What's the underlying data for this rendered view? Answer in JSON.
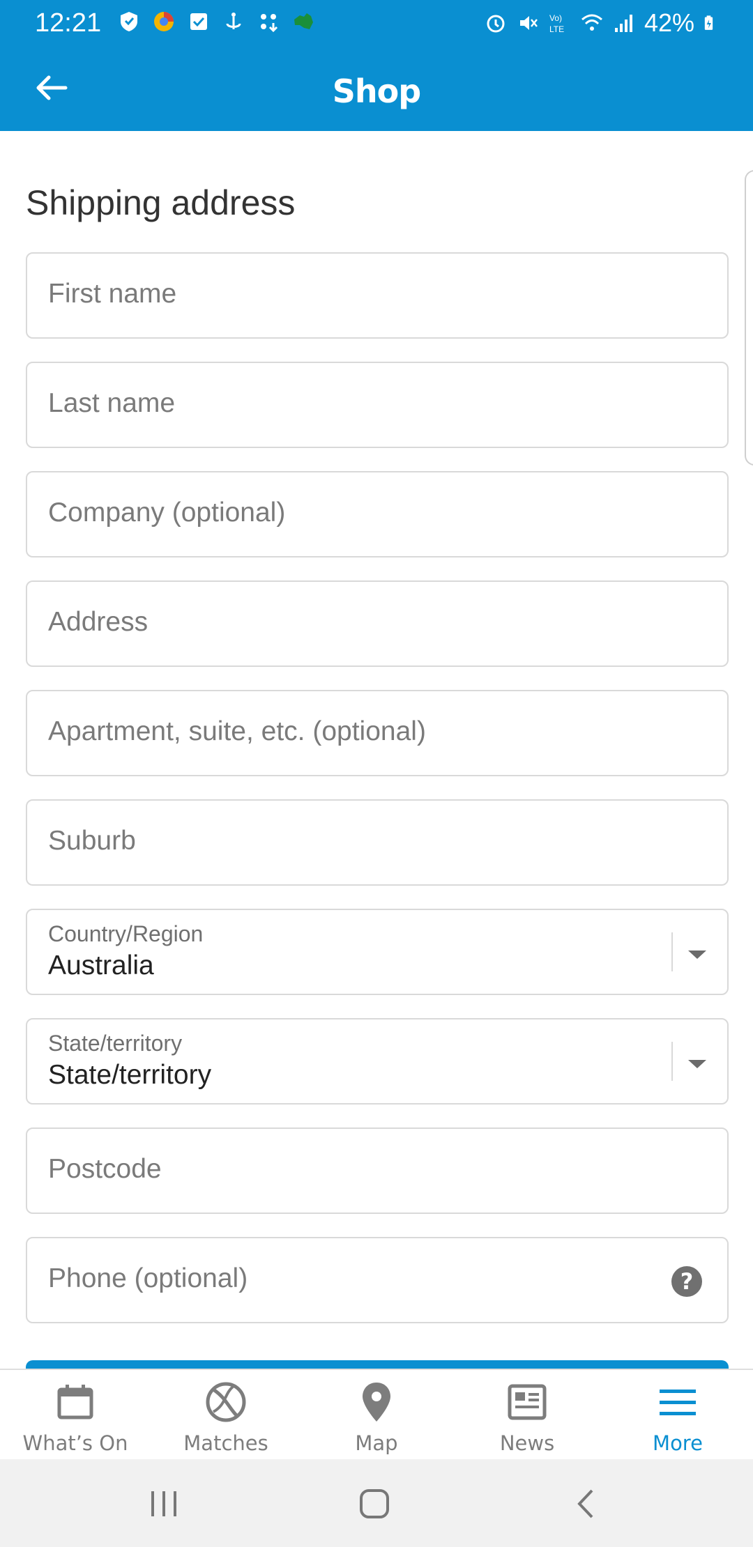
{
  "status_bar": {
    "time": "12:21",
    "battery": "42%",
    "left_icons": [
      "shield-icon",
      "browser-icon",
      "checkbox-app-icon",
      "anchor-icon",
      "apps-download-icon",
      "map-australia-icon"
    ],
    "right_icons": [
      "alarm-icon",
      "mute-icon",
      "volte-icon",
      "wifi-icon",
      "signal-icon",
      "battery-charging-icon"
    ]
  },
  "app_bar": {
    "title": "Shop",
    "back_icon": "arrow-left-icon"
  },
  "form": {
    "section_title": "Shipping address",
    "first_name_placeholder": "First name",
    "last_name_placeholder": "Last name",
    "company_placeholder": "Company (optional)",
    "address_placeholder": "Address",
    "apartment_placeholder": "Apartment, suite, etc. (optional)",
    "suburb_placeholder": "Suburb",
    "country_label": "Country/Region",
    "country_value": "Australia",
    "state_label": "State/territory",
    "state_value": "State/territory",
    "postcode_placeholder": "Postcode",
    "phone_placeholder": "Phone (optional)",
    "help_glyph": "?"
  },
  "bottom_nav": {
    "items": [
      {
        "label": "What’s On",
        "icon": "calendar-icon",
        "active": false
      },
      {
        "label": "Matches",
        "icon": "ball-icon",
        "active": false
      },
      {
        "label": "Map",
        "icon": "map-pin-icon",
        "active": false
      },
      {
        "label": "News",
        "icon": "newspaper-icon",
        "active": false
      },
      {
        "label": "More",
        "icon": "menu-icon",
        "active": true
      }
    ]
  },
  "colors": {
    "brand": "#0a8fd1",
    "field_border": "#d9d9d9",
    "inactive_nav": "#7d7d7d"
  }
}
